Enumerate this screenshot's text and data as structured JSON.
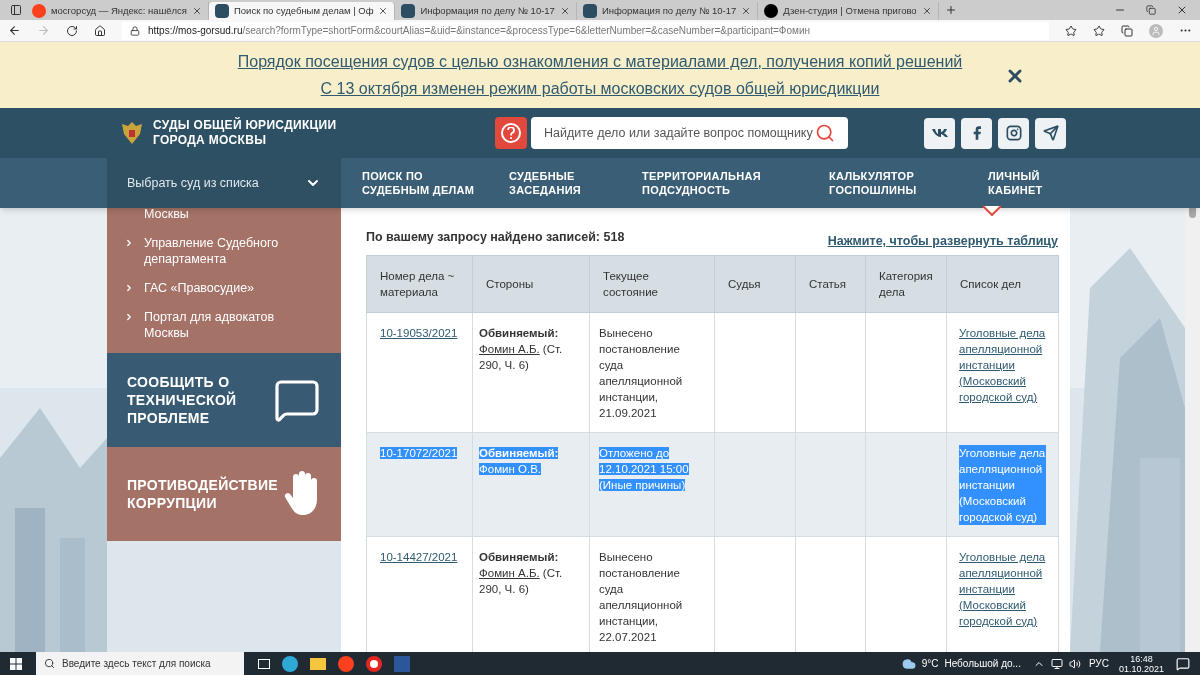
{
  "browser": {
    "tabs": [
      {
        "title": "мосгорсуд — Яндекс: нашёлся",
        "selected": false
      },
      {
        "title": "Поиск по судебным делам | Оф",
        "selected": true
      },
      {
        "title": "Информация по делу № 10-17",
        "selected": false
      },
      {
        "title": "Информация по делу № 10-17",
        "selected": false
      },
      {
        "title": "Дзен-студия | Отмена пригово",
        "selected": false
      }
    ],
    "url_host": "https://mos-gorsud.ru",
    "url_path": "/search?formType=shortForm&courtAlias=&uid=&instance=&processType=6&letterNumber=&caseNumber=&participant=Фомин"
  },
  "banner": {
    "links": [
      "Порядок посещения судов с целью ознакомления с материалами дел, получения копий решений",
      "С 13 октября изменен режим работы московских судов общей юрисдикции"
    ]
  },
  "header": {
    "title_lines": [
      "СУДЫ ОБЩЕЙ ЮРИСДИКЦИИ",
      "ГОРОДА МОСКВЫ"
    ],
    "search_placeholder": "Найдите дело или задайте вопрос помощнику"
  },
  "nav": {
    "court_select": "Выбрать суд из списка",
    "items": [
      {
        "lines": [
          "ПОИСК ПО",
          "СУДЕБНЫМ ДЕЛАМ"
        ],
        "selected": false
      },
      {
        "lines": [
          "СУДЕБНЫЕ",
          "ЗАСЕДАНИЯ"
        ],
        "selected": false
      },
      {
        "lines": [
          "ТЕРРИТОРИАЛЬНАЯ",
          "ПОДСУДНОСТЬ"
        ],
        "selected": false
      },
      {
        "lines": [
          "КАЛЬКУЛЯТОР",
          "ГОСПОШЛИНЫ"
        ],
        "selected": false
      },
      {
        "lines": [
          "ЛИЧНЫЙ",
          "КАБИНЕТ"
        ],
        "selected": true
      }
    ]
  },
  "sidebar": {
    "cut_item": "Москвы",
    "links": [
      "Управление Судебного департамента",
      "ГАС «Правосудие»",
      "Портал для адвокатов Москвы"
    ],
    "cards": [
      {
        "kind": "report",
        "lines": [
          "СООБЩИТЬ О",
          "ТЕХНИЧЕСКОЙ",
          "ПРОБЛЕМЕ"
        ],
        "color": "#385b73"
      },
      {
        "kind": "anticorruption",
        "lines": [
          "ПРОТИВОДЕЙСТВИЕ",
          "КОРРУПЦИИ"
        ],
        "color": "#a57267"
      }
    ]
  },
  "results": {
    "summary": "По вашему запросу найдено записей: 518",
    "expand_link": "Нажмите, чтобы развернуть таблицу",
    "columns": [
      "Номер дела ~ материала",
      "Стороны",
      "Текущее состояние",
      "Судья",
      "Статья",
      "Категория дела",
      "Список дел"
    ],
    "rows": [
      {
        "case_number": "10-19053/2021",
        "party_role": "Обвиняемый:",
        "party_name": "Фомин А.Б.",
        "party_note": " (Ст. 290, Ч. 6)",
        "status": "Вынесено постановление суда апелляционной инстанции, 21.09.2021",
        "list_name": "Уголовные дела апелляционной инстанции (Московский городской суд)",
        "highlighted": false
      },
      {
        "case_number": "10-17072/2021",
        "party_role": "Обвиняемый:",
        "party_name": "Фомин О.В.",
        "status": "Отложено до 12.10.2021 15:00 (Иные причины)",
        "list_name": "Уголовные дела апелляционной инстанции (Московский городской суд)",
        "highlighted": true
      },
      {
        "case_number": "10-14427/2021",
        "party_role": "Обвиняемый:",
        "party_name": "Фомин А.Б.",
        "party_note": " (Ст. 290, Ч. 6)",
        "status": "Вынесено постановление суда апелляционной инстанции, 22.07.2021",
        "list_name": "Уголовные дела апелляционной инстанции (Московский городской суд)",
        "highlighted": false
      }
    ]
  },
  "taskbar": {
    "search_placeholder": "Введите здесь текст для поиска",
    "temperature": "9°C",
    "weather": "Небольшой до...",
    "language": "РУС",
    "time": "16:48",
    "date": "01.10.2021"
  }
}
